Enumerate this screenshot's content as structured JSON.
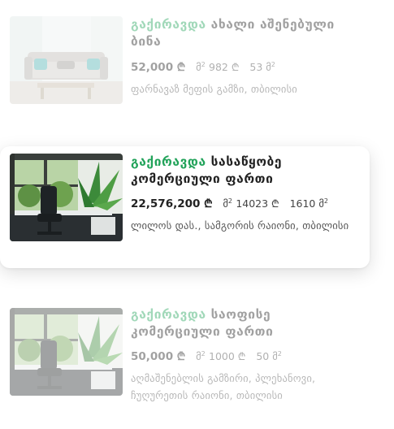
{
  "listings": [
    {
      "tag": "გაქირავდა",
      "title": "ახალი აშენებული ბინა",
      "price": "52,000 ₾",
      "area_unit": "მ",
      "area_value": "982 ₾",
      "area_total": "53 მ",
      "address": "ფარნავაზ მეფის გამზი, თბილისი"
    },
    {
      "tag": "გაქირავდა",
      "title": "სასაწყობე კომერციული ფართი",
      "price": "22,576,200 ₾",
      "area_unit": "მ",
      "area_value": "14023 ₾",
      "area_total": "1610 მ",
      "address": "ლილოს დას., სამგორის რაიონი, თბილისი"
    },
    {
      "tag": "გაქირავდა",
      "title": "საოფისე კომერციული ფართი",
      "price": "50,000 ₾",
      "area_unit": "მ",
      "area_value": "1000 ₾",
      "area_total": "50 მ",
      "address": "აღმაშენებლის გამზირი, პლეხანოვი, ჩუღურეთის რაიონი, თბილისი"
    }
  ],
  "colors": {
    "tag": "#22a35a",
    "text": "#222222",
    "muted": "#555555"
  }
}
